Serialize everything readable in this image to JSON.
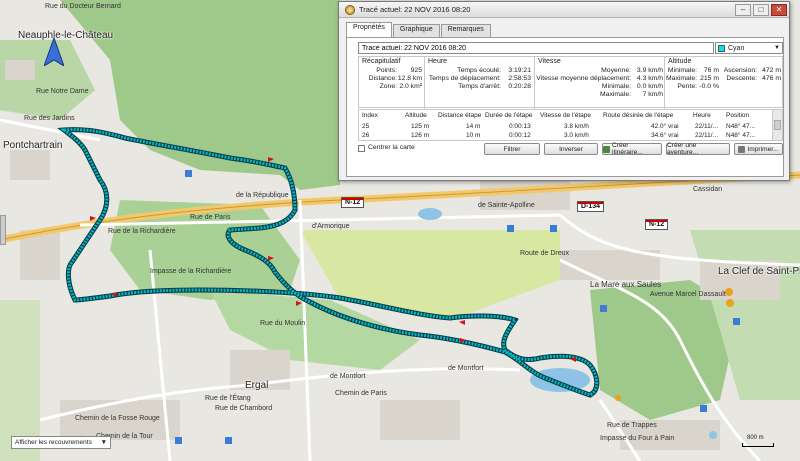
{
  "map": {
    "places": [
      {
        "id": "rue-doc",
        "text": "Rue du Docteur Bernard"
      },
      {
        "id": "neauphle",
        "text": "Neauphle-le-Château"
      },
      {
        "id": "pontchartrain",
        "text": "Pontchartrain"
      },
      {
        "id": "la-republique",
        "text": "de la République"
      },
      {
        "id": "armorique",
        "text": "d'Armorique"
      },
      {
        "id": "cassidan",
        "text": "Cassidan"
      },
      {
        "id": "sainte-apolline",
        "text": "de Sainte-Apolline"
      },
      {
        "id": "dreux",
        "text": "Route de Dreux"
      },
      {
        "id": "la-clef",
        "text": "La Clef de Saint-Pierre"
      },
      {
        "id": "mare-saules",
        "text": "La Mare aux Saules"
      },
      {
        "id": "marcel-dassault",
        "text": "Avenue Marcel Dassault"
      },
      {
        "id": "rue-paris",
        "text": "Rue de Paris"
      },
      {
        "id": "richardiere",
        "text": "Rue de la Richardière"
      },
      {
        "id": "epinoche",
        "text": "Impasse de la Richardière"
      },
      {
        "id": "moulin",
        "text": "Rue du Moulin"
      },
      {
        "id": "montfort1",
        "text": "de Montfort"
      },
      {
        "id": "montfort2",
        "text": "de Montfort"
      },
      {
        "id": "ergal",
        "text": "Ergal"
      },
      {
        "id": "chemin-paris",
        "text": "Chemin de Paris"
      },
      {
        "id": "fosse-rouge",
        "text": "Chemin de la Fosse Rouge"
      },
      {
        "id": "tour",
        "text": "Chemin de la Tour"
      },
      {
        "id": "rue-etang",
        "text": "Rue de l'Étang"
      },
      {
        "id": "chambord",
        "text": "Rue de Chambord"
      },
      {
        "id": "trappes",
        "text": "Rue de Trappes"
      },
      {
        "id": "four",
        "text": "Impasse du Four à Pain"
      },
      {
        "id": "rue-oie",
        "text": "Rue des Jardins"
      },
      {
        "id": "nd",
        "text": "Rue Notre Dame"
      }
    ],
    "shields": [
      "N-12",
      "D-134",
      "N-12"
    ],
    "overlay_select": "Afficher les recouvrements",
    "scale_label": "800 m",
    "track_color": "#00b8c4"
  },
  "dialog": {
    "title": "Tracé actuel: 22 NOV 2016 08:20",
    "tabs": [
      "Propriétés",
      "Graphique",
      "Remarques"
    ],
    "name_value": "Tracé actuel: 22 NOV 2016 08:20",
    "color": {
      "label": "Cyan",
      "hex": "#00e5ee"
    },
    "recap": {
      "head": "Récapitulatif",
      "rows": [
        {
          "k": "Points:",
          "v": "925"
        },
        {
          "k": "Distance:",
          "v": "12.8 km"
        },
        {
          "k": "Zone:",
          "v": "2.0 km²"
        }
      ]
    },
    "heure": {
      "head": "Heure",
      "rows": [
        {
          "k": "Temps écoulé:",
          "v": "3:19:21"
        },
        {
          "k": "Temps de déplacement:",
          "v": "2:58:53"
        },
        {
          "k": "Temps d'arrêt:",
          "v": "0:20:28"
        }
      ]
    },
    "vitesse": {
      "head": "Vitesse",
      "rows": [
        {
          "k": "Moyenne:",
          "v": "3.9 km/h"
        },
        {
          "k": "Vitesse moyenne déplacement:",
          "v": "4.3 km/h"
        },
        {
          "k": "Minimale:",
          "v": "0.0 km/h"
        },
        {
          "k": "Maximale:",
          "v": "7 km/h"
        }
      ]
    },
    "altitude": {
      "head": "Altitude",
      "rows": [
        {
          "k": "Minimale:",
          "v": "76 m",
          "k2": "Ascension:",
          "v2": "472 m"
        },
        {
          "k": "Maximale:",
          "v": "215 m",
          "k2": "Descente:",
          "v2": "476 m"
        },
        {
          "k": "Pente:",
          "v": "-0.0 %"
        }
      ]
    },
    "table": {
      "headers": [
        "Index",
        "Altitude",
        "Distance étape",
        "Durée de l'étape",
        "Vitesse de l'étape",
        "Route désirée de l'étape",
        "Heure",
        "Position"
      ],
      "rows": [
        [
          "25",
          "125 m",
          "14 m",
          "0:00:13",
          "3.8 km/h",
          "42.0° vrai",
          "22/11/...",
          "N48° 47..."
        ],
        [
          "26",
          "126 m",
          "10 m",
          "0:00:12",
          "3.0 km/h",
          "34.6° vrai",
          "22/11/...",
          "N48° 47..."
        ]
      ]
    },
    "center_map": "Centrer la carte",
    "buttons": {
      "filter": "Filtrer",
      "invert": "Inverser",
      "create_route": "Créer itinéraire...",
      "create_adventure": "Créer une aventure...",
      "print": "Imprimer..."
    }
  }
}
